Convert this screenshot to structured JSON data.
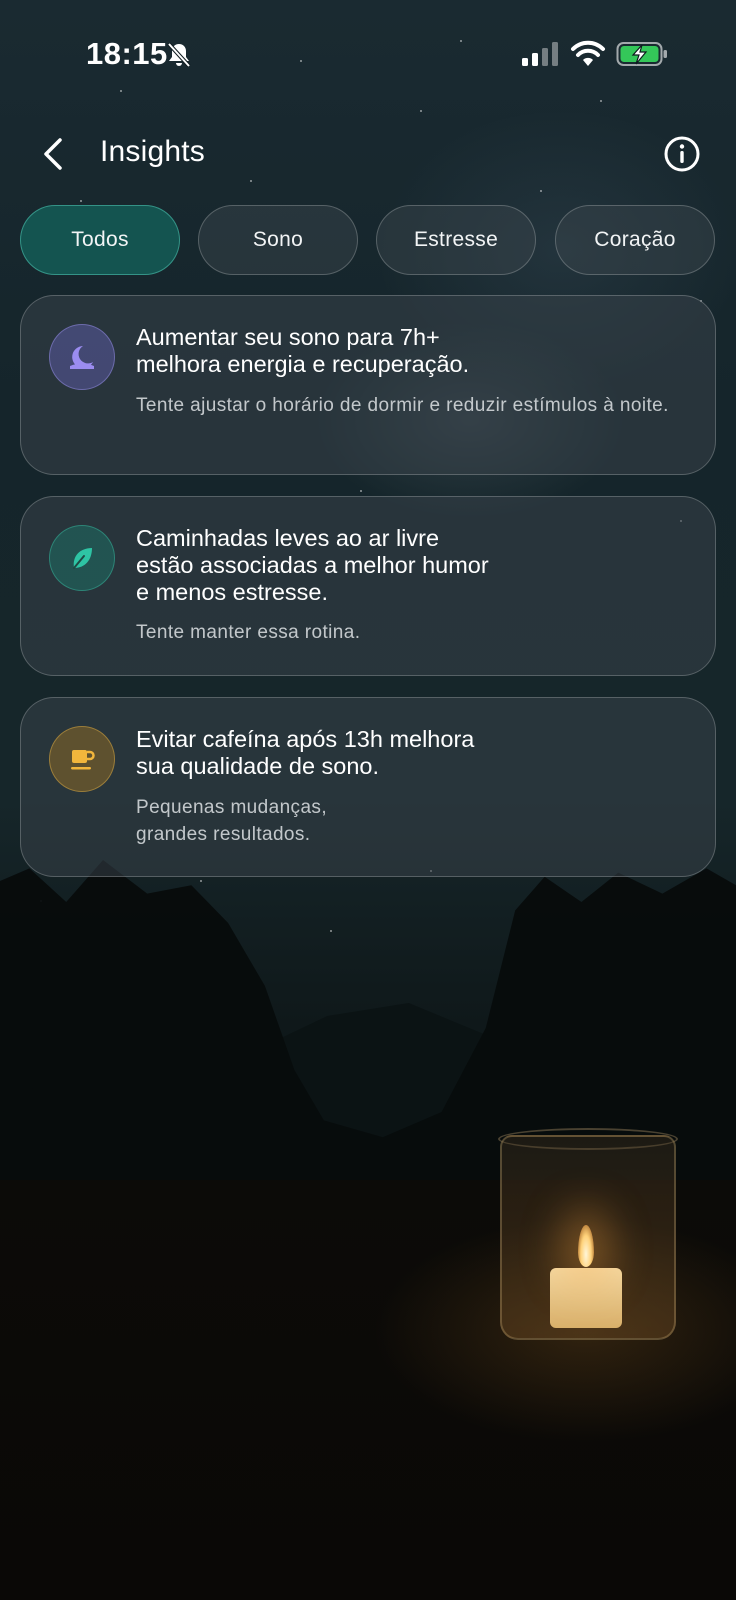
{
  "status_bar": {
    "time": "18:15"
  },
  "header": {
    "title": "Insights"
  },
  "tabs": [
    {
      "label": "Todos",
      "active": true
    },
    {
      "label": "Sono",
      "active": false
    },
    {
      "label": "Estresse",
      "active": false
    },
    {
      "label": "Coração",
      "active": false
    }
  ],
  "cards": [
    {
      "icon": "moon-icon",
      "accent": "#9b8cf0",
      "title": "Aumentar seu sono para 7h+\nmelhora energia e recuperação.",
      "text": "Tente ajustar o horário de dormir e reduzir estímulos à noite."
    },
    {
      "icon": "leaf-icon",
      "accent": "#2ec4a4",
      "title": "Caminhadas leves ao ar livre\nestão associadas a melhor humor\ne menos estresse.",
      "text": "Tente manter essa rotina."
    },
    {
      "icon": "coffee-cup-icon",
      "accent": "#f2b63c",
      "title": "Evitar cafeína após 13h melhora\nsua qualidade de sono.",
      "text": "Pequenas mudanças,\ngrandes resultados."
    }
  ]
}
